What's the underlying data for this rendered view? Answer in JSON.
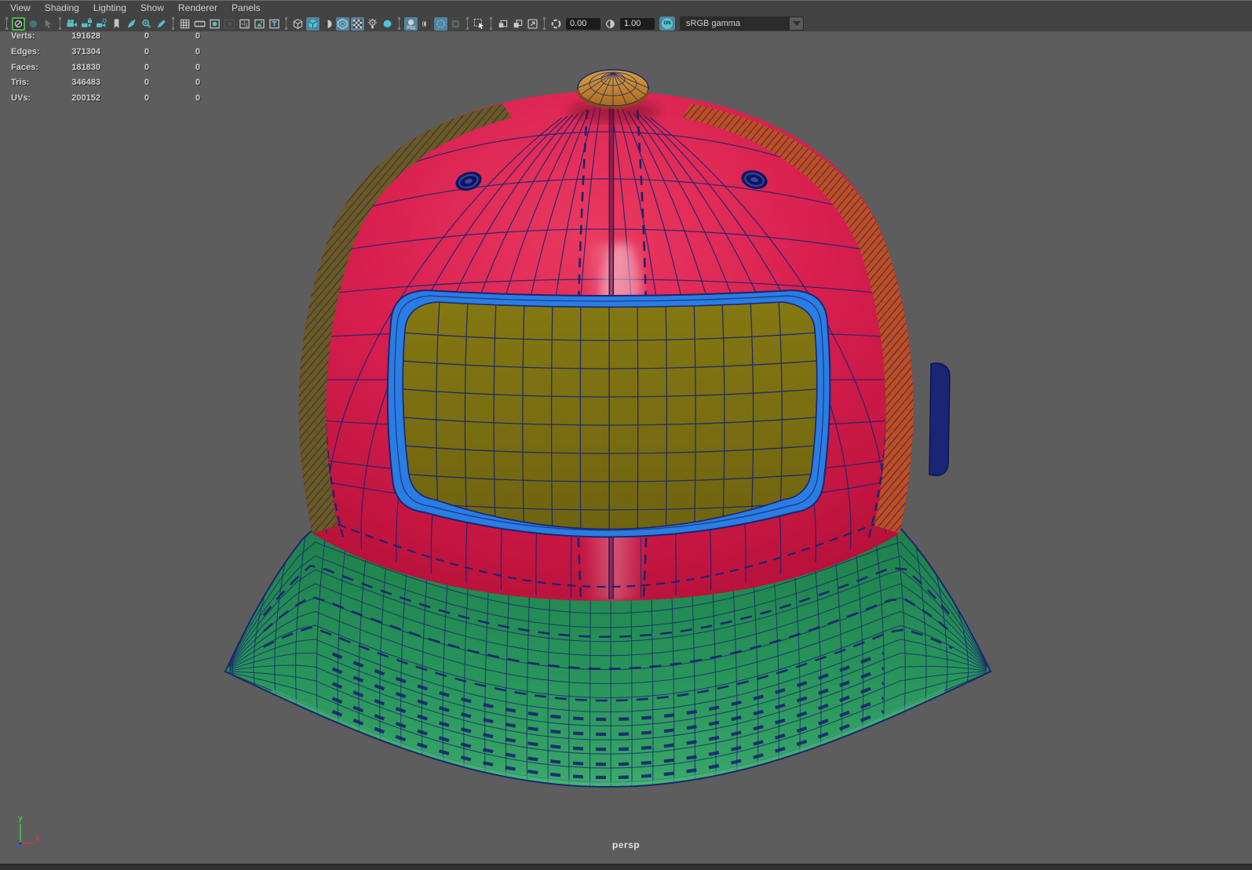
{
  "menu": {
    "items": [
      "View",
      "Shading",
      "Lighting",
      "Show",
      "Renderer",
      "Panels"
    ]
  },
  "toolbar": {
    "controls": [
      {
        "type": "sep"
      },
      {
        "type": "icon",
        "name": "viewport-renderer-icon",
        "kind": "slashCircle",
        "tint": "gray",
        "state": "selected"
      },
      {
        "type": "icon",
        "name": "circle-icon",
        "kind": "circle",
        "tint": "teal",
        "state": "disabled"
      },
      {
        "type": "icon",
        "name": "arrow-cursor-icon",
        "kind": "cursor",
        "tint": "gray",
        "state": "disabled"
      },
      {
        "type": "sep"
      },
      {
        "type": "icon",
        "name": "select-camera-icon",
        "kind": "camera",
        "tint": "teal"
      },
      {
        "type": "icon",
        "name": "lock-camera-icon",
        "kind": "cameraLock",
        "tint": "teal"
      },
      {
        "type": "icon",
        "name": "camera-attributes-icon",
        "kind": "cameraGear",
        "tint": "teal"
      },
      {
        "type": "icon",
        "name": "bookmark-icon",
        "kind": "flag",
        "tint": "gray"
      },
      {
        "type": "icon",
        "name": "grease-pencil-icon",
        "kind": "pencil",
        "tint": "teal"
      },
      {
        "type": "icon",
        "name": "pan-zoom-icon",
        "kind": "magPlus",
        "tint": "teal"
      },
      {
        "type": "icon",
        "name": "marker-icon",
        "kind": "pen",
        "tint": "teal"
      },
      {
        "type": "sep"
      },
      {
        "type": "icon",
        "name": "grid-icon",
        "kind": "grid",
        "tint": "gray"
      },
      {
        "type": "icon",
        "name": "film-gate-icon",
        "kind": "film",
        "tint": "gray"
      },
      {
        "type": "icon",
        "name": "resolution-gate-icon",
        "kind": "resGate",
        "tint": "gray"
      },
      {
        "type": "icon",
        "name": "gate-mask-icon",
        "kind": "gateMask",
        "tint": "gray",
        "state": "disabled"
      },
      {
        "type": "icon",
        "name": "field-chart-icon",
        "kind": "fieldChart",
        "tint": "gray"
      },
      {
        "type": "icon",
        "name": "safe-action-icon",
        "kind": "safeAction",
        "tint": "gray"
      },
      {
        "type": "icon",
        "name": "safe-title-icon",
        "kind": "safeTitle",
        "tint": "gray"
      },
      {
        "type": "sep"
      },
      {
        "type": "icon",
        "name": "wireframe-icon",
        "kind": "cubeWire",
        "tint": "gray"
      },
      {
        "type": "icon",
        "name": "smooth-shaded-icon",
        "kind": "cubeShaded",
        "tint": "teal",
        "state": "active"
      },
      {
        "type": "icon",
        "name": "textured-icon",
        "kind": "sphereHalf",
        "tint": "gray"
      },
      {
        "type": "icon",
        "name": "wireframe-on-shaded-icon",
        "kind": "cubeInCube",
        "tint": "gray",
        "state": "active"
      },
      {
        "type": "icon",
        "name": "textures-icon",
        "kind": "checker",
        "tint": "gray",
        "state": "active"
      },
      {
        "type": "icon",
        "name": "lights-icon",
        "kind": "bulb",
        "tint": "gray"
      },
      {
        "type": "icon",
        "name": "shadows-icon",
        "kind": "sphere",
        "tint": "teal"
      },
      {
        "type": "sep"
      },
      {
        "type": "icon",
        "name": "ssao-icon",
        "kind": "ssao",
        "tint": "gray",
        "state": "active"
      },
      {
        "type": "icon",
        "name": "motion-blur-icon",
        "kind": "motionBlur",
        "tint": "gray"
      },
      {
        "type": "icon",
        "name": "anti-aliasing-icon",
        "kind": "aaCircle",
        "tint": "teal",
        "state": "active"
      },
      {
        "type": "icon",
        "name": "depth-of-field-icon",
        "kind": "dofCube",
        "tint": "gray",
        "state": "disabled"
      },
      {
        "type": "sep"
      },
      {
        "type": "icon",
        "name": "isolate-select-icon",
        "kind": "isolate",
        "tint": "gray"
      },
      {
        "type": "sep"
      },
      {
        "type": "icon",
        "name": "pan-2d-icon",
        "kind": "sqPair",
        "tint": "gray"
      },
      {
        "type": "icon",
        "name": "zoom-2d-icon",
        "kind": "sqPair2",
        "tint": "gray"
      },
      {
        "type": "icon",
        "name": "region-zoom-icon",
        "kind": "sqArrow",
        "tint": "gray"
      },
      {
        "type": "sep"
      },
      {
        "type": "icon",
        "name": "exposure-icon",
        "kind": "aperture",
        "tint": "gray"
      },
      {
        "type": "field",
        "name": "exposure-field",
        "value": "0.00"
      },
      {
        "type": "icon",
        "name": "contrast-icon",
        "kind": "contrast",
        "tint": "gray"
      },
      {
        "type": "field",
        "name": "gamma-field",
        "value": "1.00"
      },
      {
        "type": "toggle",
        "name": "color-management-toggle",
        "label": "ON"
      },
      {
        "type": "select",
        "name": "view-transform-select",
        "value": "sRGB gamma"
      }
    ]
  },
  "hud": {
    "rows": [
      {
        "label": "Verts:",
        "v1": "191628",
        "v2": "0",
        "v3": "0"
      },
      {
        "label": "Edges:",
        "v1": "371304",
        "v2": "0",
        "v3": "0"
      },
      {
        "label": "Faces:",
        "v1": "181830",
        "v2": "0",
        "v3": "0"
      },
      {
        "label": "Tris:",
        "v1": "346483",
        "v2": "0",
        "v3": "0"
      },
      {
        "label": "UVs:",
        "v1": "200152",
        "v2": "0",
        "v3": "0"
      }
    ]
  },
  "viewport": {
    "camera_label": "persp",
    "axis": {
      "x": "x",
      "y": "y"
    }
  },
  "colors": {
    "background": "#5d5d5d",
    "topbar": "#434343",
    "bottombar": "#323232",
    "wire": "#1b2470",
    "crown": "#d92050",
    "crown_dark": "#b31038",
    "crown_highlight": "#ff9aa8",
    "brim": "#27945a",
    "brim_dark": "#1e7f4b",
    "brim_light": "#3fae6e",
    "patch": "#7a6e12",
    "patch_border": "#2a7de2",
    "button_orange": "#cf9031",
    "side_left": "#6d5a1e",
    "side_right": "#c14e1f",
    "tag": "#1a2576",
    "axis_x": "#cf3a3a",
    "axis_y": "#4bbf4b",
    "axis_z": "#3c52e0",
    "icon_teal": "#55c0cc",
    "icon_gray": "#c4c4c4",
    "icon_active_bg": "#54839f",
    "icon_selected_border": "#4fb352"
  }
}
